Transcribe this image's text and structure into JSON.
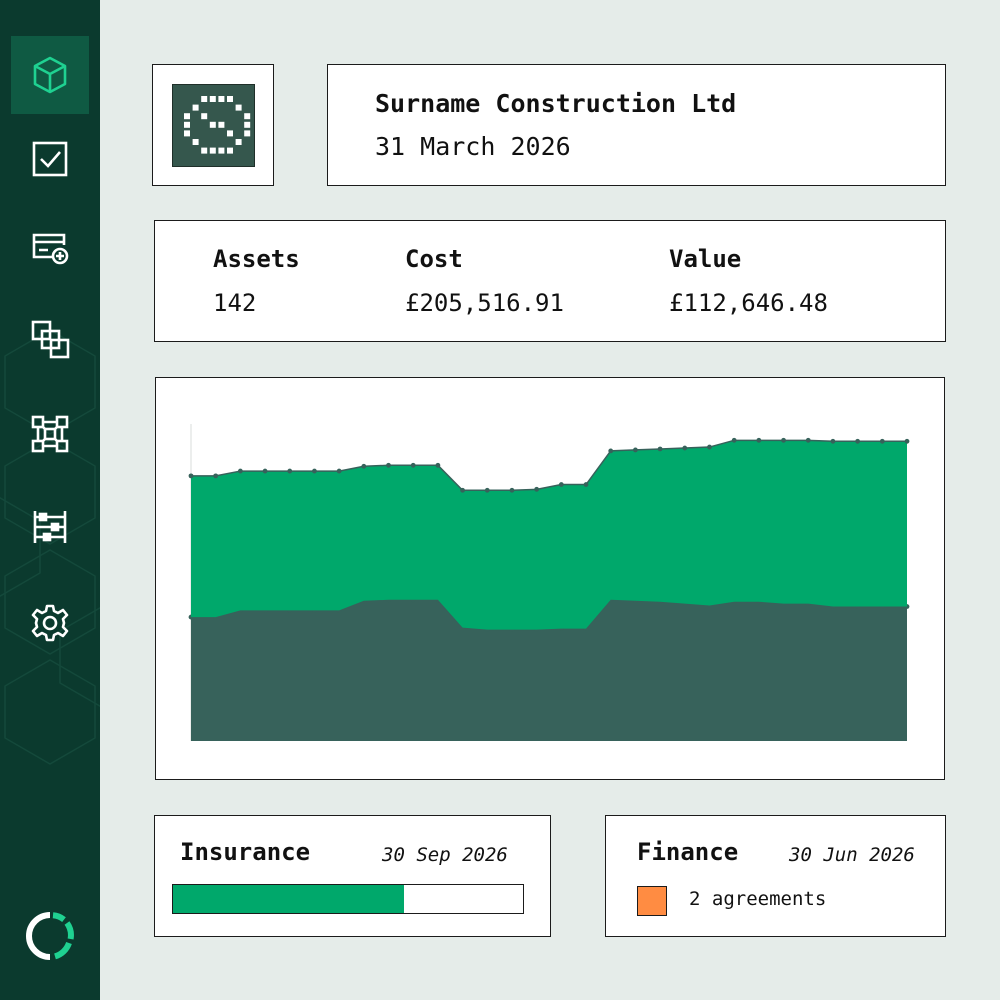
{
  "sidebar": {
    "items": [
      {
        "id": "assets",
        "icon": "cube-icon",
        "active": true
      },
      {
        "id": "tasks",
        "icon": "checkbox-icon",
        "active": false
      },
      {
        "id": "add-card",
        "icon": "card-add-icon",
        "active": false
      },
      {
        "id": "copy",
        "icon": "copy-squares-icon",
        "active": false
      },
      {
        "id": "network",
        "icon": "network-icon",
        "active": false
      },
      {
        "id": "ledger",
        "icon": "ledger-icon",
        "active": false
      },
      {
        "id": "settings",
        "icon": "gear-icon",
        "active": false
      }
    ],
    "logo_icon": "circular-logo-icon"
  },
  "company": {
    "name": "Surname Construction Ltd",
    "date": "31 March 2026"
  },
  "stats": {
    "assets_label": "Assets",
    "assets_value": "142",
    "cost_label": "Cost",
    "cost_value": "£205,516.91",
    "value_label": "Value",
    "value_value": "£112,646.48"
  },
  "insurance": {
    "title": "Insurance",
    "date": "30 Sep 2026",
    "progress": 0.66
  },
  "finance": {
    "title": "Finance",
    "date": "30 Jun 2026",
    "agreements": "2 agreements"
  },
  "colors": {
    "accent": "#00a86b",
    "dark_series": "#37625b",
    "sidebar": "#0b3a2e",
    "sidebar_active": "#0f5a43",
    "finance_swatch": "#ff8c42",
    "background": "#e5ece9"
  },
  "chart_data": {
    "type": "area",
    "stacked": true,
    "x": [
      1,
      2,
      3,
      4,
      5,
      6,
      7,
      8,
      9,
      10,
      11,
      12,
      13,
      14,
      15,
      16,
      17,
      18,
      19,
      20,
      21,
      22,
      23,
      24,
      25,
      26,
      27,
      28,
      29,
      30
    ],
    "ylim": [
      0,
      330
    ],
    "grid": false,
    "legend": "none",
    "series": [
      {
        "color": "#37625b",
        "values": [
          129,
          129,
          136,
          136,
          136,
          136,
          136,
          146,
          147,
          147,
          147,
          118,
          116,
          116,
          116,
          117,
          117,
          147,
          146,
          145,
          143,
          141,
          145,
          145,
          143,
          143,
          140,
          140,
          140,
          140
        ]
      },
      {
        "color": "#00a86b",
        "values": [
          147,
          147,
          145,
          145,
          145,
          145,
          145,
          140,
          140,
          140,
          140,
          143,
          145,
          145,
          146,
          150,
          150,
          155,
          157,
          159,
          162,
          165,
          168,
          168,
          170,
          170,
          172,
          172,
          172,
          172
        ]
      }
    ]
  }
}
